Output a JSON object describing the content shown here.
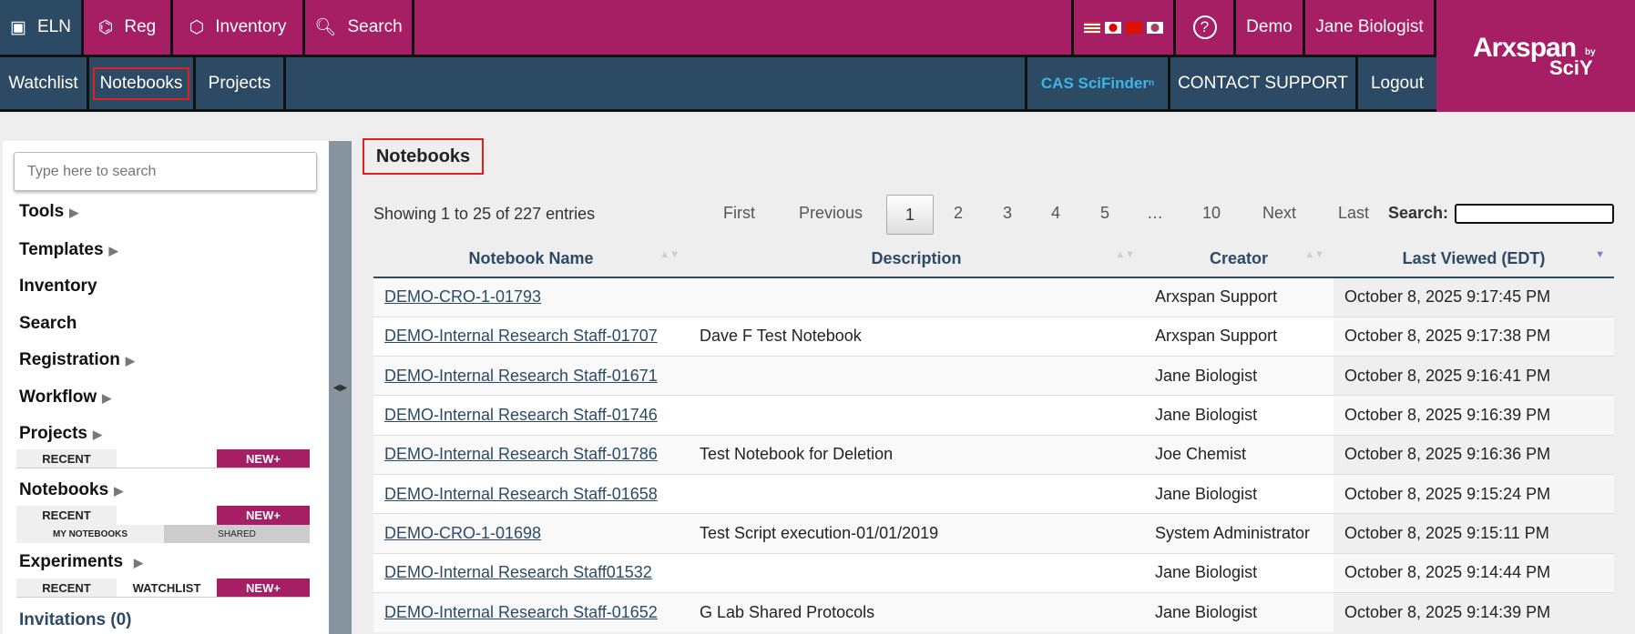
{
  "topnav": {
    "eln": "ELN",
    "reg": "Reg",
    "inventory": "Inventory",
    "search": "Search",
    "demo": "Demo",
    "user": "Jane Biologist",
    "help_icon": "question-circle-icon"
  },
  "subnav": {
    "watchlist": "Watchlist",
    "notebooks": "Notebooks",
    "projects": "Projects",
    "cas": "CAS SciFinder",
    "cas_sup": "n",
    "contact": "CONTACT SUPPORT",
    "logout": "Logout"
  },
  "logo": {
    "main": "Arxspan",
    "by": "by",
    "sub": "SciY"
  },
  "sidebar": {
    "search_placeholder": "Type here to search",
    "tools": "Tools",
    "templates": "Templates",
    "inventory": "Inventory",
    "search": "Search",
    "registration": "Registration",
    "workflow": "Workflow",
    "projects": "Projects",
    "notebooks": "Notebooks",
    "experiments": "Experiments",
    "invitations": "Invitations (0)",
    "recent": "RECENT",
    "new": "NEW+",
    "watchlist": "WATCHLIST",
    "my_notebooks": "MY NOTEBOOKS",
    "shared": "SHARED"
  },
  "main": {
    "title": "Notebooks",
    "showing": "Showing 1 to 25 of 227 entries",
    "pagination": {
      "first": "First",
      "previous": "Previous",
      "pages": [
        "1",
        "2",
        "3",
        "4",
        "5",
        "…",
        "10"
      ],
      "next": "Next",
      "last": "Last"
    },
    "search_label": "Search:",
    "columns": [
      "Notebook Name",
      "Description",
      "Creator",
      "Last Viewed (EDT)"
    ],
    "rows": [
      [
        "DEMO-CRO-1-01793",
        "",
        "Arxspan Support",
        "October 8, 2025 9:17:45 PM"
      ],
      [
        "DEMO-Internal Research Staff-01707",
        "Dave F Test Notebook",
        "Arxspan Support",
        "October 8, 2025 9:17:38 PM"
      ],
      [
        "DEMO-Internal Research Staff-01671",
        "",
        "Jane Biologist",
        "October 8, 2025 9:16:41 PM"
      ],
      [
        "DEMO-Internal Research Staff-01746",
        "",
        "Jane Biologist",
        "October 8, 2025 9:16:39 PM"
      ],
      [
        "DEMO-Internal Research Staff-01786",
        "Test Notebook for Deletion",
        "Joe Chemist",
        "October 8, 2025 9:16:36 PM"
      ],
      [
        "DEMO-Internal Research Staff-01658",
        "",
        "Jane Biologist",
        "October 8, 2025 9:15:24 PM"
      ],
      [
        "DEMO-CRO-1-01698",
        "Test Script execution-01/01/2019",
        "System Administrator",
        "October 8, 2025 9:15:11 PM"
      ],
      [
        "DEMO-Internal Research Staff01532",
        "",
        "Jane Biologist",
        "October 8, 2025 9:14:44 PM"
      ],
      [
        "DEMO-Internal Research Staff-01652",
        "G Lab Shared Protocols",
        "Jane Biologist",
        "October 8, 2025 9:14:39 PM"
      ]
    ]
  }
}
